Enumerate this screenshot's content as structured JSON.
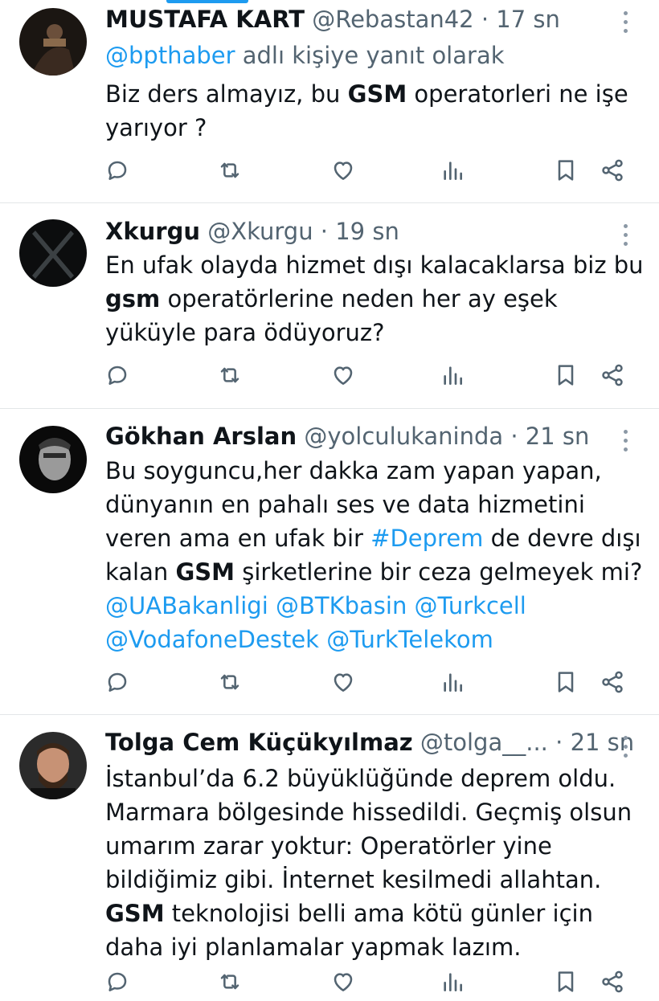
{
  "tweets": [
    {
      "name": "MUSTAFA KART",
      "handle": "@Rebastan42",
      "sep": "·",
      "time": "17 sn",
      "reply_to_user": "@bpthaber",
      "reply_to_suffix": " adlı kişiye yanıt olarak",
      "text": {
        "p1": "Biz ders almayız, bu ",
        "b1": "GSM",
        "p2": " operatorleri ne işe yarıyor ?"
      }
    },
    {
      "name": "Xkurgu",
      "handle": "@Xkurgu",
      "sep": "·",
      "time": "19 sn",
      "text": {
        "p1": "En ufak olayda hizmet dışı kalacaklarsa biz bu ",
        "b1": "gsm",
        "p2": " operatörlerine neden her ay eşek yüküyle para ödüyoruz?"
      }
    },
    {
      "name": "Gökhan Arslan",
      "handle": "@yolculukaninda",
      "sep": "·",
      "time": "21 sn",
      "text": {
        "p1": "Bu soyguncu,her dakka zam yapan yapan, dünyanın en pahalı ses ve data hizmetini veren ama en ufak bir ",
        "hashtag": "#Deprem",
        "p2": " de devre dışı kalan ",
        "b1": "GSM",
        "p3": " şirketlerine bir ceza gelmeyek mi?",
        "m1": "@UABakanligi",
        "m2": "@BTKbasin",
        "m3": "@Turkcell",
        "m4": "@VodafoneDestek",
        "m5": "@TurkTelekom"
      }
    },
    {
      "name": "Tolga Cem Küçükyılmaz",
      "handle": "@tolga__...",
      "sep": "·",
      "time": "21 sn",
      "text": {
        "p1": "İstanbul’da 6.2 büyüklüğünde deprem oldu. Marmara bölgesinde hissedildi. Geçmiş olsun umarım zarar yoktur: Operatörler yine bildiğimiz gibi. İnternet kesilmedi allahtan.",
        "b1": "GSM",
        "p2": " teknolojisi belli ama kötü günler için daha iyi planlamalar yapmak lazım."
      }
    }
  ],
  "action_icons": [
    "reply-icon",
    "retweet-icon",
    "like-icon",
    "views-icon",
    "bookmark-icon",
    "share-icon"
  ],
  "colors": {
    "link": "#1d9bf0",
    "secondary": "#536471",
    "text": "#0f1419",
    "icon": "#536471"
  }
}
